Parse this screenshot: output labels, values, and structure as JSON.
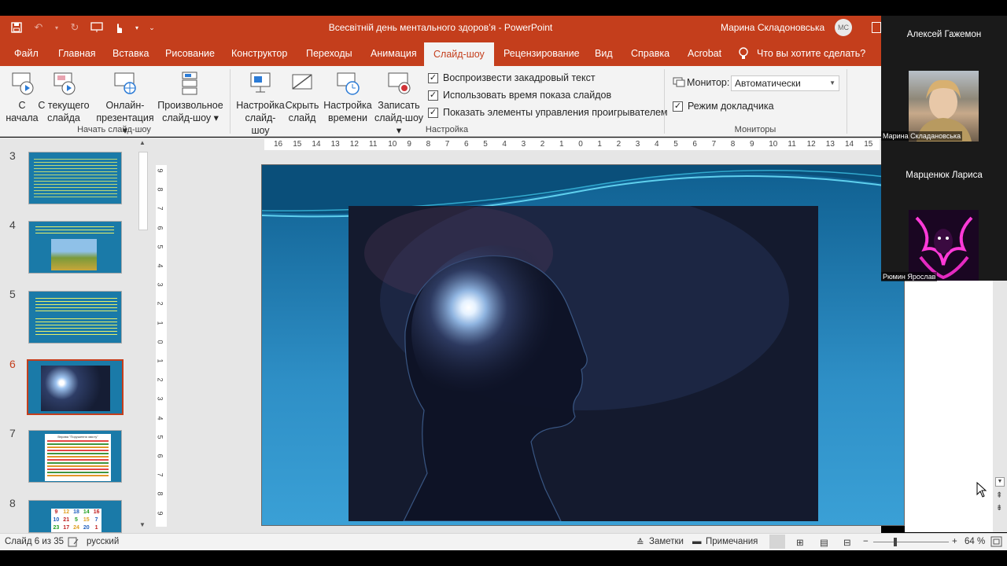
{
  "window": {
    "doc_title": "Всесвітній день ментального здоров’я  -  PowerPoint",
    "user_name": "Марина  Складоновська",
    "user_initials": "МС"
  },
  "tabs": [
    "Файл",
    "Главная",
    "Вставка",
    "Рисование",
    "Конструктор",
    "Переходы",
    "Анимация",
    "Слайд-шоу",
    "Рецензирование",
    "Вид",
    "Справка",
    "Acrobat",
    "Что вы хотите сделать?"
  ],
  "ribbon": {
    "start": {
      "from_start_l1": "С",
      "from_start_l2": "начала",
      "from_current_l1": "С текущего",
      "from_current_l2": "слайда",
      "online_l1": "Онлайн-",
      "online_l2": "презентация",
      "custom_l1": "Произвольное",
      "custom_l2": "слайд-шоу",
      "group_label": "Начать слайд-шоу"
    },
    "setup": {
      "setup_l1": "Настройка",
      "setup_l2": "слайд-шоу",
      "hide_l1": "Скрыть",
      "hide_l2": "слайд",
      "timing_l1": "Настройка",
      "timing_l2": "времени",
      "record_l1": "Записать",
      "record_l2": "слайд-шоу",
      "chk_narration": "Воспроизвести закадровый текст",
      "chk_timings": "Использовать время показа слайдов",
      "chk_media": "Показать элементы управления проигрывателем",
      "group_label": "Настройка"
    },
    "monitors": {
      "monitor_label": "Монитор:",
      "monitor_value": "Автоматически",
      "presenter_view": "Режим докладчика",
      "group_label": "Мониторы"
    }
  },
  "thumbs": {
    "n3": "3",
    "n4": "4",
    "n5": "5",
    "n6": "6",
    "n7": "7",
    "n8": "8",
    "t7_title": "Вправа \"Порушення змісту\"",
    "t8_cells": [
      "9",
      "12",
      "18",
      "14",
      "16",
      "10",
      "21",
      "5",
      "15",
      "7",
      "23",
      "17",
      "24",
      "20",
      "1"
    ]
  },
  "ruler": {
    "h": [
      "16",
      "15",
      "14",
      "13",
      "12",
      "11",
      "10",
      "9",
      "8",
      "7",
      "6",
      "5",
      "4",
      "3",
      "2",
      "1",
      "0",
      "1",
      "2",
      "3",
      "4",
      "5",
      "6",
      "7",
      "8",
      "9",
      "10",
      "11",
      "12",
      "13",
      "14",
      "15"
    ],
    "v": [
      "9",
      "8",
      "7",
      "6",
      "5",
      "4",
      "3",
      "2",
      "1",
      "0",
      "1",
      "2",
      "3",
      "4",
      "5",
      "6",
      "7",
      "8",
      "9"
    ]
  },
  "status": {
    "slide_info": "Слайд 6 из 35",
    "language": "русский",
    "notes": "Заметки",
    "comments": "Примечания",
    "zoom": "64 %"
  },
  "participants": {
    "p1_name": "Алексей Гажемон",
    "p2_caption": "Марина Складановська",
    "p3_name": "Марценюк Лариса",
    "p4_caption": "Рюмин Ярослав"
  }
}
